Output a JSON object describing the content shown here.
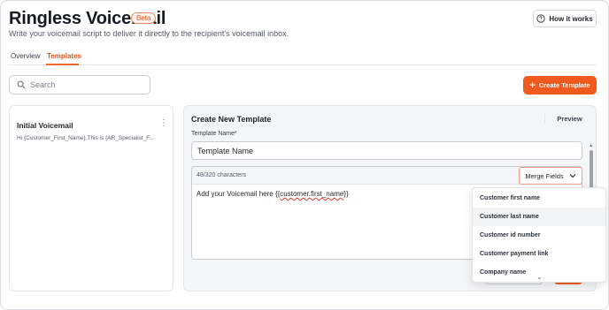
{
  "header": {
    "title": "Ringless Voicemail",
    "badge": "Beta",
    "subtitle": "Write your voicemail script to deliver it directly to the recipient's voicemail inbox.",
    "how_it_works": "How it works"
  },
  "tabs": [
    {
      "label": "Overview",
      "active": false
    },
    {
      "label": "Templates",
      "active": true
    }
  ],
  "search": {
    "placeholder": "Search"
  },
  "create_button": "Create Template",
  "templates": [
    {
      "title": "Initial Voicemail",
      "preview": "Hi {Customer_First_Name},This is {AR_Specialist_F..."
    }
  ],
  "editor": {
    "title": "Create New Template",
    "preview_button": "Preview",
    "name_label": "Template Name*",
    "name_value": "Template Name",
    "char_count": "48/320 characters",
    "merge_fields_label": "Merge Fields",
    "message_prefix": "Add your Voicemail here {{",
    "message_token": "customer.first_name",
    "message_suffix": "}}"
  },
  "merge_fields": [
    "Customer first name",
    "Customer last name",
    "Customer id number",
    "Customer payment link",
    "Company name"
  ],
  "colors": {
    "accent": "#f05a1e",
    "tab_active": "#e0541c"
  }
}
